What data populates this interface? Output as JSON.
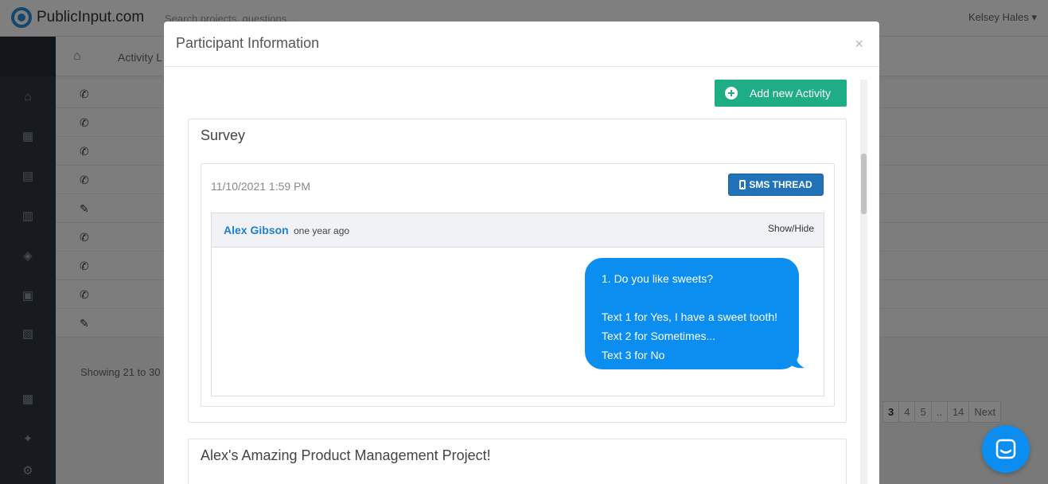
{
  "app": {
    "logo_text": "PublicInput.com",
    "search_placeholder": "Search projects, questions...",
    "user_name": "Kelsey Hales ▾"
  },
  "breadcrumb": {
    "label": "Activity L"
  },
  "list": {
    "row_icons": [
      "phone",
      "phone",
      "phone",
      "phone",
      "pencil",
      "phone",
      "phone",
      "phone",
      "pencil"
    ],
    "showing_text": "Showing 21 to 30",
    "pagination": [
      "3",
      "4",
      "5",
      "..",
      "14",
      "Next"
    ]
  },
  "modal": {
    "title": "Participant Information",
    "close_label": "×",
    "add_activity_label": "Add new Activity",
    "survey_panel": {
      "title": "Survey",
      "timestamp": "11/10/2021 1:59 PM",
      "sms_button_label": "SMS THREAD",
      "thread": {
        "author": "Alex Gibson",
        "time_ago": "one year ago",
        "toggle_label": "Show/Hide",
        "message_lines": [
          "1. Do you like sweets?",
          "",
          "Text 1 for Yes, I have a sweet tooth!",
          "Text 2 for Sometimes...",
          "Text 3 for No"
        ]
      }
    },
    "project_panel": {
      "title": "Alex's Amazing Product Management Project!"
    }
  },
  "colors": {
    "accent_green": "#1fad86",
    "sms_blue": "#2172b8",
    "bubble_blue": "#0b8ef0",
    "link_blue": "#1f7fd0",
    "sidebar": "#2f3641"
  }
}
